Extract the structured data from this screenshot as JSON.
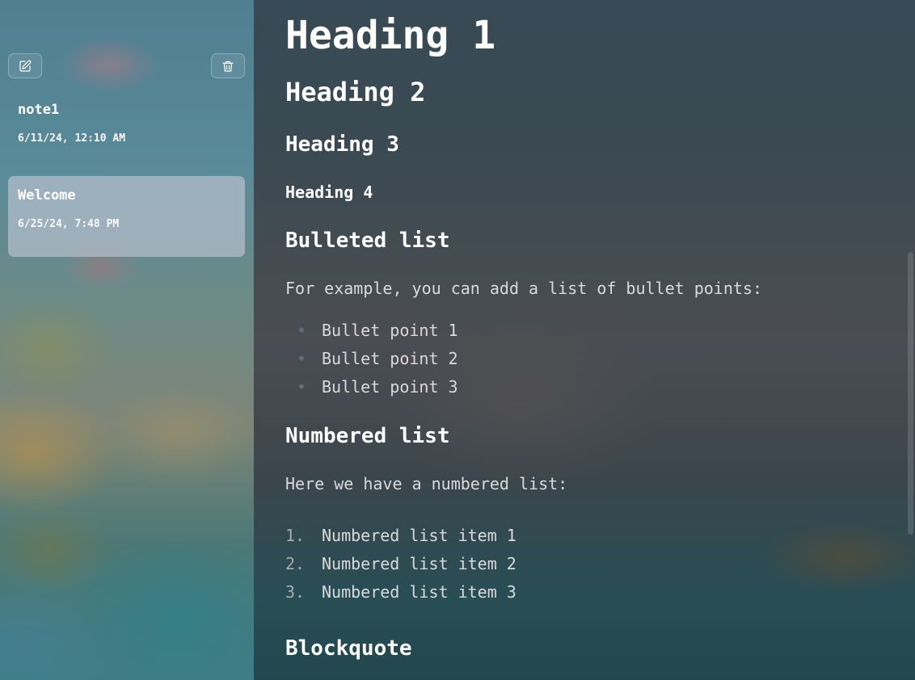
{
  "sidebar": {
    "new_note_icon": "compose-icon",
    "delete_icon": "trash-icon",
    "notes": [
      {
        "title": "note1",
        "date": "6/11/24, 12:10 AM",
        "selected": false
      },
      {
        "title": "Welcome",
        "date": "6/25/24, 7:48 PM",
        "selected": true
      }
    ]
  },
  "editor": {
    "h1": "Heading 1",
    "h2": "Heading 2",
    "h3": "Heading 3",
    "h4": "Heading 4",
    "bulleted_heading": "Bulleted list",
    "bulleted_intro": "For example, you can add a list of bullet points:",
    "bullets": [
      "Bullet point 1",
      "Bullet point 2",
      "Bullet point 3"
    ],
    "bullet_marker": "•",
    "numbered_heading": "Numbered list",
    "numbered_intro": "Here we have a numbered list:",
    "numbered": [
      {
        "marker": "1.",
        "text": "Numbered list item 1"
      },
      {
        "marker": "2.",
        "text": "Numbered list item 2"
      },
      {
        "marker": "3.",
        "text": "Numbered list item 3"
      }
    ],
    "blockquote_heading": "Blockquote"
  },
  "colors": {
    "selected_note_bg": "#c3c6d7",
    "text": "#ffffff",
    "bullet_marker": "#5d6f7a",
    "number_marker": "#a6acb2"
  }
}
